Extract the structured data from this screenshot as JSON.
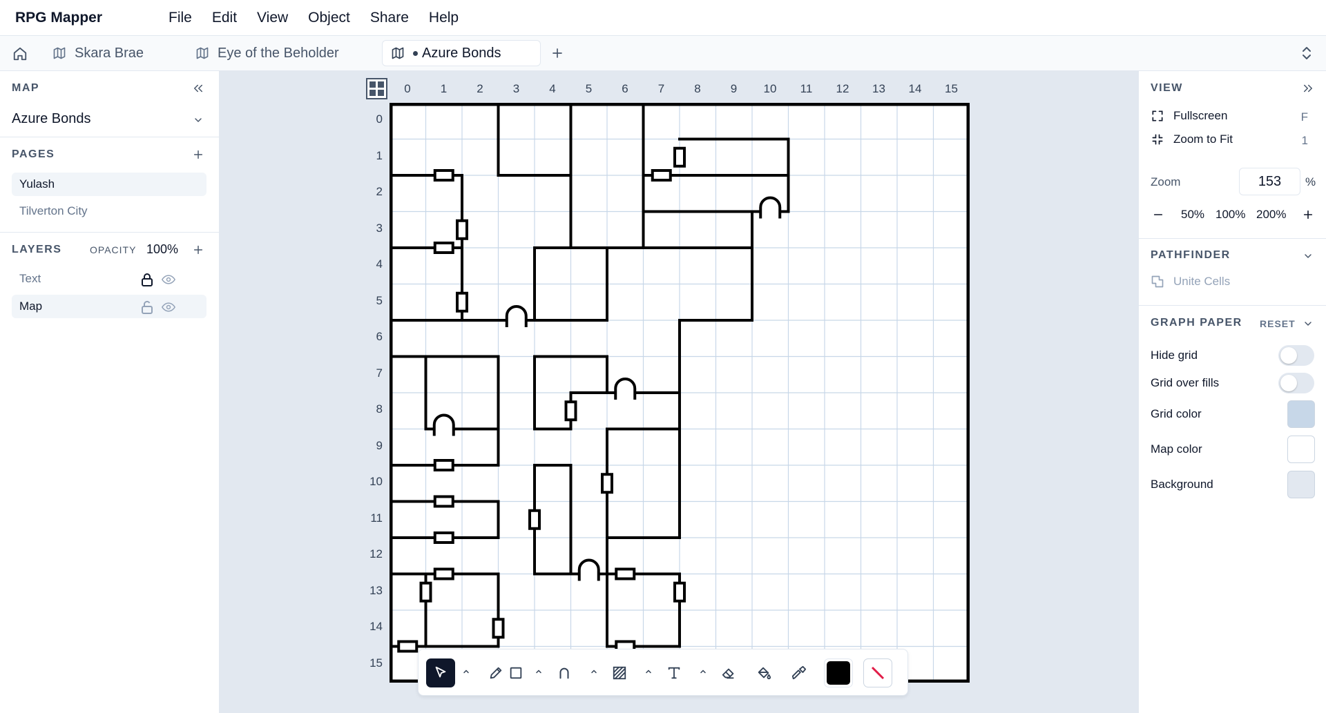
{
  "app": {
    "title": "RPG Mapper"
  },
  "menu": [
    "File",
    "Edit",
    "View",
    "Object",
    "Share",
    "Help"
  ],
  "tabs": [
    {
      "label": "Skara Brae",
      "active": false,
      "modified": false
    },
    {
      "label": "Eye of the Beholder",
      "active": false,
      "modified": false
    },
    {
      "label": "Azure Bonds",
      "active": true,
      "modified": true
    }
  ],
  "left": {
    "map_label": "MAP",
    "map_name": "Azure Bonds",
    "pages_label": "PAGES",
    "pages": [
      {
        "label": "Yulash",
        "selected": true
      },
      {
        "label": "Tilverton City",
        "selected": false
      }
    ],
    "layers_label": "LAYERS",
    "opacity_label": "OPACITY",
    "opacity_value": "100%",
    "layers": [
      {
        "label": "Text",
        "locked": true,
        "visible": true,
        "selected": false
      },
      {
        "label": "Map",
        "locked": false,
        "visible": true,
        "selected": true
      }
    ]
  },
  "canvas": {
    "columns": [
      "0",
      "1",
      "2",
      "3",
      "4",
      "5",
      "6",
      "7",
      "8",
      "9",
      "10",
      "11",
      "12",
      "13",
      "14",
      "15"
    ],
    "rows": [
      "0",
      "1",
      "2",
      "3",
      "4",
      "5",
      "6",
      "7",
      "8",
      "9",
      "10",
      "11",
      "12",
      "13",
      "14",
      "15"
    ],
    "grid_color": "#c7d7e8",
    "map_color": "#ffffff",
    "background": "#e2e8f0"
  },
  "toolbar": {
    "tools": [
      "select-tool",
      "pencil-tool",
      "rectangle-tool",
      "door-tool",
      "hatch-tool",
      "text-tool",
      "eraser-tool",
      "fill-tool",
      "eyedropper-tool"
    ],
    "fill_color": "#000000",
    "stroke_color": "#e11d48"
  },
  "right": {
    "view_label": "VIEW",
    "fullscreen_label": "Fullscreen",
    "fullscreen_key": "F",
    "zoom_fit_label": "Zoom to Fit",
    "zoom_fit_key": "1",
    "zoom_label": "Zoom",
    "zoom_value": "153",
    "zoom_unit": "%",
    "zoom_presets": [
      "50%",
      "100%",
      "200%"
    ],
    "pathfinder_label": "PATHFINDER",
    "unite_label": "Unite Cells",
    "graph_label": "GRAPH PAPER",
    "reset_label": "RESET",
    "hide_grid_label": "Hide grid",
    "hide_grid_on": false,
    "grid_over_fills_label": "Grid over fills",
    "grid_over_fills_on": false,
    "grid_color_label": "Grid color",
    "map_color_label": "Map color",
    "background_label": "Background",
    "grid_color": "#c7d7e8",
    "map_color": "#ffffff",
    "background_color": "#e2e8f0"
  }
}
